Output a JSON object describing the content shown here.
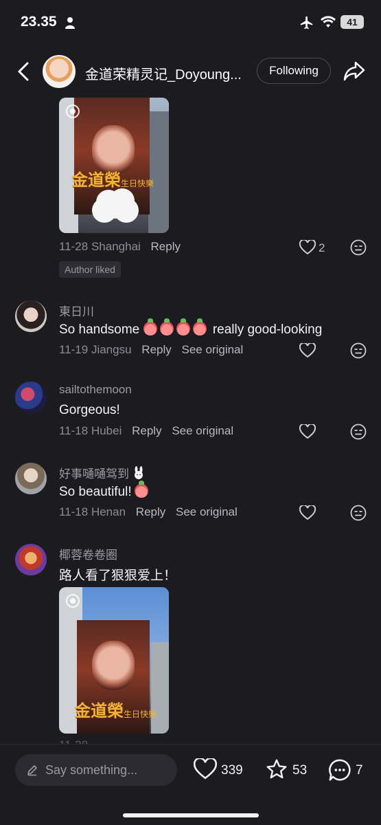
{
  "status_bar": {
    "time": "23.35",
    "battery": "41"
  },
  "header": {
    "title": "金道荣精灵记_Doyoung...",
    "follow_label": "Following"
  },
  "top_comment": {
    "date": "11-28",
    "location": "Shanghai",
    "reply_label": "Reply",
    "like_count": "2",
    "badge": "Author liked",
    "photo_text": {
      "main": "金道榮",
      "sub": "生日快樂"
    }
  },
  "comments": [
    {
      "user": "東日川",
      "text_a": "So handsome",
      "text_b": "really good-looking",
      "date": "11-19",
      "location": "Jiangsu",
      "reply_label": "Reply",
      "original_label": "See original"
    },
    {
      "user": "sailtothemoon",
      "text": "Gorgeous!",
      "date": "11-18",
      "location": "Hubei",
      "reply_label": "Reply",
      "original_label": "See original"
    },
    {
      "user": "好事嗵嗵驾到",
      "text": "So beautiful!",
      "date": "11-18",
      "location": "Henan",
      "reply_label": "Reply",
      "original_label": "See original"
    },
    {
      "user": "椰蓉卷卷圈",
      "text": "路人看了狠狠爱上！",
      "photo_text": {
        "main": "金道榮",
        "sub": "生日快樂"
      }
    }
  ],
  "bottom_bar": {
    "placeholder": "Say something...",
    "likes": "339",
    "favorites": "53",
    "comments": "7"
  },
  "colors": {
    "background": "#1c1c20",
    "text": "#f2f2f2",
    "muted": "#8d8d95",
    "gold": "#f1b437"
  }
}
